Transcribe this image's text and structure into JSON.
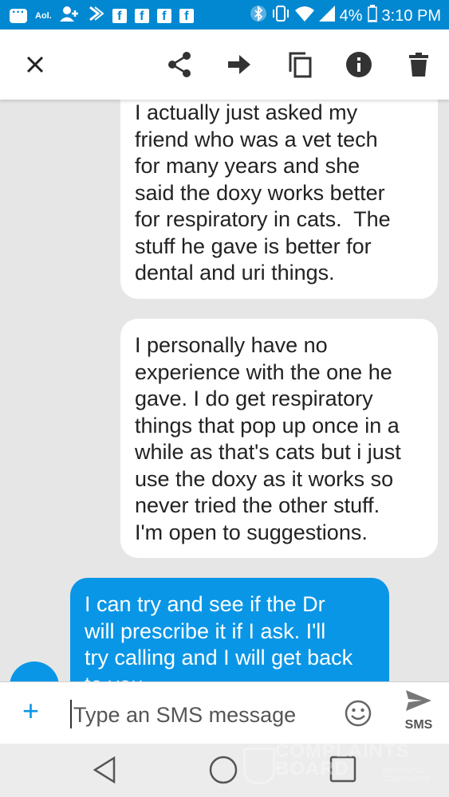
{
  "status_bar": {
    "aol_label": "Aol.",
    "fb_glyph": "f",
    "battery": "4%",
    "time": "3:10 PM",
    "icons": [
      "chat-icon",
      "aol-icon",
      "add-person-icon",
      "sprint-icon",
      "facebook-icon",
      "facebook-icon",
      "facebook-icon",
      "facebook-icon",
      "bluetooth-icon",
      "vibrate-icon",
      "wifi-icon",
      "signal-icon",
      "battery-icon"
    ]
  },
  "toolbar": {
    "icons": [
      "close-icon",
      "share-icon",
      "forward-icon",
      "copy-icon",
      "info-icon",
      "delete-icon"
    ]
  },
  "messages": [
    {
      "direction": "incoming",
      "lines": [
        "I actually just asked my",
        "friend who was a vet tech",
        "for many years and she",
        "said the doxy works better",
        "for respiratory in cats.  The",
        "stuff he gave is better for",
        "dental and uri things."
      ]
    },
    {
      "direction": "incoming",
      "lines": [
        "I personally have no",
        "experience with the one he",
        "gave. I do get respiratory",
        "things that pop up once in a",
        "while as that's cats but i just",
        "use the doxy as it works so",
        "never tried the other stuff.",
        "I'm open to suggestions."
      ]
    },
    {
      "direction": "outgoing",
      "lines": [
        "I can try and see if the Dr",
        "will prescribe it if I ask. I'll",
        "try calling and I will get back",
        "to you."
      ]
    }
  ],
  "compose": {
    "add_label": "+",
    "placeholder": "Type an SMS message",
    "send_label": "SMS"
  },
  "watermark": {
    "line1": "COMPLAINTS",
    "line2": "BOARD",
    "sub": "RESOLVING COMPLAINTS"
  },
  "colors": {
    "status_bar": "#0288d1",
    "outgoing_bubble": "#0a96e6",
    "background": "#e6e6e6"
  }
}
